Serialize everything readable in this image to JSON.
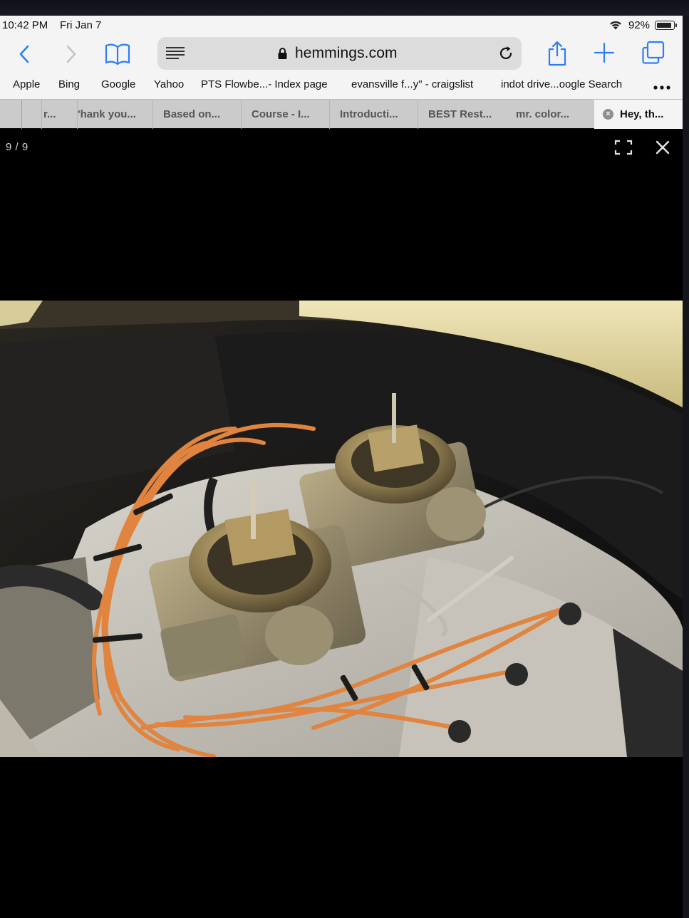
{
  "status": {
    "time": "10:42 PM",
    "date": "Fri Jan 7",
    "battery": "92%",
    "battery_level": 0.92
  },
  "toolbar": {
    "url": "hemmings.com"
  },
  "favorites": [
    "Apple",
    "Bing",
    "Google",
    "Yahoo",
    "PTS Flowbe...- Index page",
    "evansville f...y\" - craigslist",
    "indot drive...oogle Search"
  ],
  "tabs": [
    "r...",
    "'hank you...",
    "Based on...",
    "Course - I...",
    "Introducti...",
    "BEST Rest...",
    "mr. color...",
    "Hey, th..."
  ],
  "viewer": {
    "counter": "9 / 9"
  },
  "icons": {
    "back": "chevron-left-icon",
    "forward": "chevron-right-icon",
    "bookmarks": "open-book-icon",
    "reader": "reader-mode-icon",
    "lock": "lock-icon",
    "reload": "reload-icon",
    "share": "share-icon",
    "new_tab": "plus-icon",
    "tabs": "tabs-icon",
    "more": "ellipsis-icon",
    "fullscreen": "fullscreen-icon",
    "close": "close-icon"
  },
  "colors": {
    "accent": "#2f7df6",
    "chrome_bg": "#f4f4f4",
    "viewer_bg": "#000000"
  }
}
